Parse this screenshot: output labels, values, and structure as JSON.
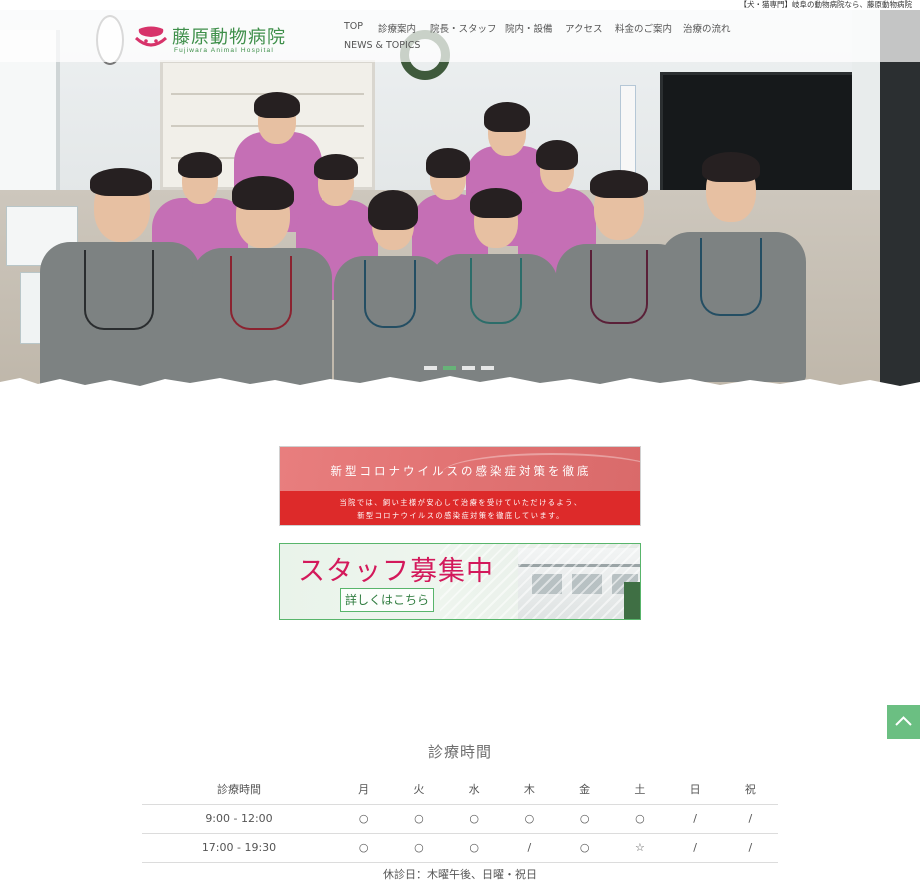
{
  "top_strip": {
    "text": "【犬・猫専門】岐阜の動物病院なら、藤原動物病院"
  },
  "logo": {
    "name": "藤原動物病院",
    "subtitle": "Fujiwara Animal Hospital"
  },
  "nav": {
    "items": [
      {
        "label": "TOP"
      },
      {
        "label": "診療案内"
      },
      {
        "label": "院長・スタッフ"
      },
      {
        "label": "院内・設備"
      },
      {
        "label": "アクセス"
      },
      {
        "label": "料金のご案内"
      },
      {
        "label": "治療の流れ"
      },
      {
        "label": "NEWS & TOPICS"
      }
    ]
  },
  "slider": {
    "slide_count": 4,
    "active_index": 1
  },
  "banners": {
    "covid": {
      "title": "新型コロナウイルスの感染症対策を徹底",
      "line1": "当院では、飼い主様が安心して治療を受けていただけるよう、",
      "line2": "新型コロナウイルスの感染症対策を徹底しています。"
    },
    "staff": {
      "heading": "スタッフ募集中",
      "button": "詳しくはこちら"
    }
  },
  "hours": {
    "title": "診療時間",
    "header_label": "診療時間",
    "days": [
      "月",
      "火",
      "水",
      "木",
      "金",
      "土",
      "日",
      "祝"
    ],
    "rows": [
      {
        "time": "9:00 - 12:00",
        "cells": [
          "○",
          "○",
          "○",
          "○",
          "○",
          "○",
          "/",
          "/"
        ]
      },
      {
        "time": "17:00 - 19:30",
        "cells": [
          "○",
          "○",
          "○",
          "/",
          "○",
          "☆",
          "/",
          "/"
        ]
      }
    ],
    "closed_note": "休診日：木曜午後、日曜・祝日"
  },
  "colors": {
    "brand_green": "#3e8f4a",
    "accent_green": "#65b877",
    "covid_red": "#dd2a2a",
    "staff_pink": "#d3195b"
  }
}
